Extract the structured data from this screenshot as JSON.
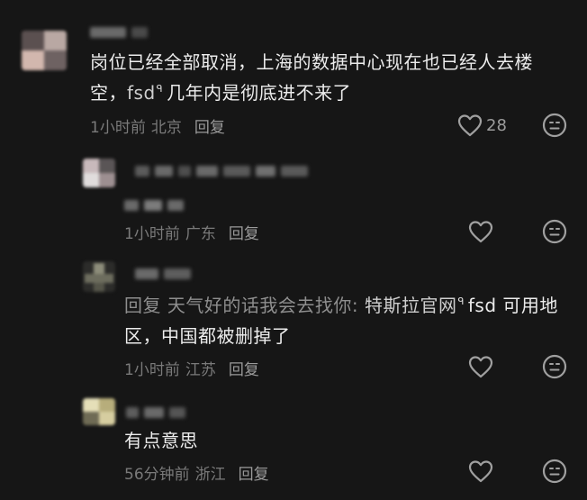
{
  "comments": [
    {
      "text_parts": [
        "岗位已经全部取消，上海的数据中心现在也已经人去楼空，",
        "fsd",
        "几年内是彻底进不来了"
      ],
      "time": "1小时前",
      "location": "北京",
      "reply_label": "回复",
      "like_count": "28"
    },
    {
      "text_parts": [],
      "time": "1小时前",
      "location": "广东",
      "reply_label": "回复",
      "like_count": ""
    },
    {
      "reply_prefix": "回复",
      "reply_to": "天气好的话我会去找你:",
      "text_parts": [
        "特斯拉官网",
        "fsd 可用地区，中国都被删掉了"
      ],
      "time": "1小时前",
      "location": "江苏",
      "reply_label": "回复",
      "like_count": ""
    },
    {
      "text_parts": [
        "有点意思"
      ],
      "time": "56分钟前",
      "location": "浙江",
      "reply_label": "回复",
      "like_count": ""
    }
  ],
  "search_mark": "ᑫ",
  "icons": {
    "like": "heart-outline-icon",
    "dislike": "meh-face-icon"
  },
  "colors": {
    "background": "#161616",
    "text": "#ececec",
    "meta": "#7a7a7a",
    "icon": "#9c9c9c"
  }
}
